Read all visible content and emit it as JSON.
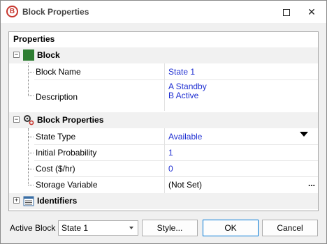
{
  "window": {
    "title": "Block Properties",
    "app_icon_letter": "B",
    "maximize_label": "",
    "close_label": "✕"
  },
  "panel": {
    "header": "Properties",
    "categories": [
      {
        "label": "Block",
        "toggle": "−",
        "icon": "green-square-icon",
        "properties": [
          {
            "name": "Block Name",
            "value": "State 1"
          },
          {
            "name": "Description",
            "value_lines": [
              "A Standby",
              "B Active"
            ]
          }
        ]
      },
      {
        "label": "Block Properties",
        "toggle": "−",
        "icon": "gears-icon",
        "properties": [
          {
            "name": "State Type",
            "value": "Available"
          },
          {
            "name": "Initial Probability",
            "value": "1"
          },
          {
            "name": "Cost ($/hr)",
            "value": "0"
          },
          {
            "name": "Storage Variable",
            "value": "(Not Set)"
          }
        ]
      },
      {
        "label": "Identifiers",
        "toggle": "+",
        "icon": "calendar-list-icon",
        "properties": []
      }
    ],
    "ellipsis": "..."
  },
  "footer": {
    "active_block_label": "Active Block",
    "active_block_value": "State 1",
    "style_button": "Style...",
    "ok_button": "OK",
    "cancel_button": "Cancel"
  },
  "colors": {
    "accent": "#0078d7",
    "value_blue": "#1e2ed1",
    "brand_red": "#c7372f",
    "block_green": "#2e7d32"
  }
}
